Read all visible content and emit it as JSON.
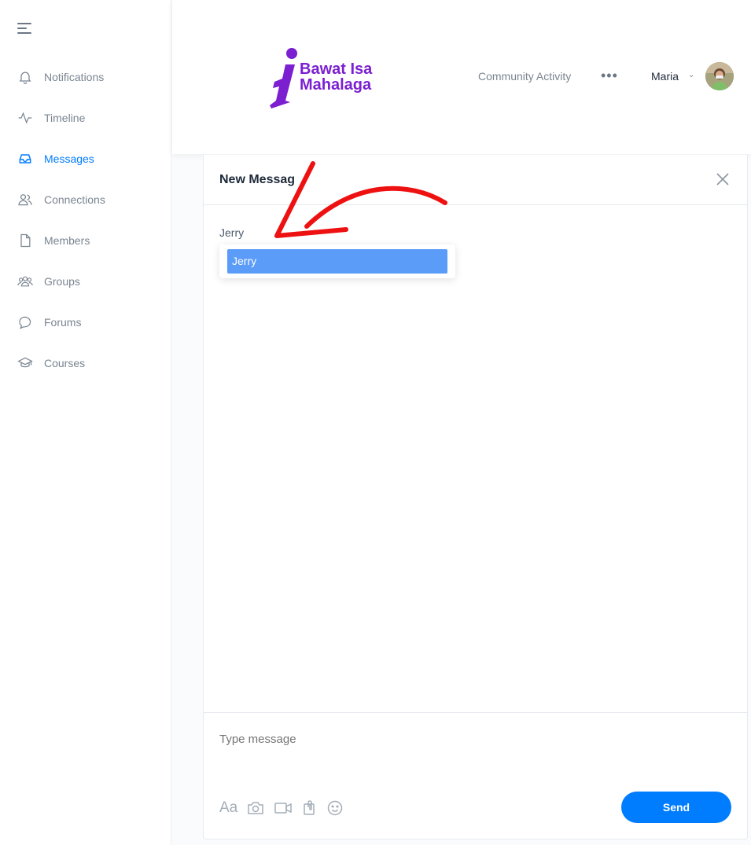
{
  "sidebar": {
    "items": [
      {
        "label": "Notifications",
        "icon": "bell-icon",
        "active": false
      },
      {
        "label": "Timeline",
        "icon": "pulse-icon",
        "active": false
      },
      {
        "label": "Messages",
        "icon": "inbox-icon",
        "active": true
      },
      {
        "label": "Connections",
        "icon": "users-icon",
        "active": false
      },
      {
        "label": "Members",
        "icon": "file-icon",
        "active": false
      },
      {
        "label": "Groups",
        "icon": "group-icon",
        "active": false
      },
      {
        "label": "Forums",
        "icon": "chat-bubble-icon",
        "active": false
      },
      {
        "label": "Courses",
        "icon": "graduation-cap-icon",
        "active": false
      }
    ]
  },
  "header": {
    "logo_line1": "Bawat Isa",
    "logo_line2": "Mahalaga",
    "nav_link": "Community Activity",
    "more": "•••",
    "user_name": "Maria",
    "chevron": "⌄"
  },
  "message": {
    "title": "New Messag",
    "recipient_value": "Jerry",
    "suggestion": "Jerry",
    "composer_placeholder": "Type message",
    "format_label": "Aa",
    "send_label": "Send"
  },
  "colors": {
    "accent": "#007cff",
    "brand": "#7b1fd1",
    "suggestion_bg": "#5a9cf8",
    "annotation": "#ee1111"
  }
}
